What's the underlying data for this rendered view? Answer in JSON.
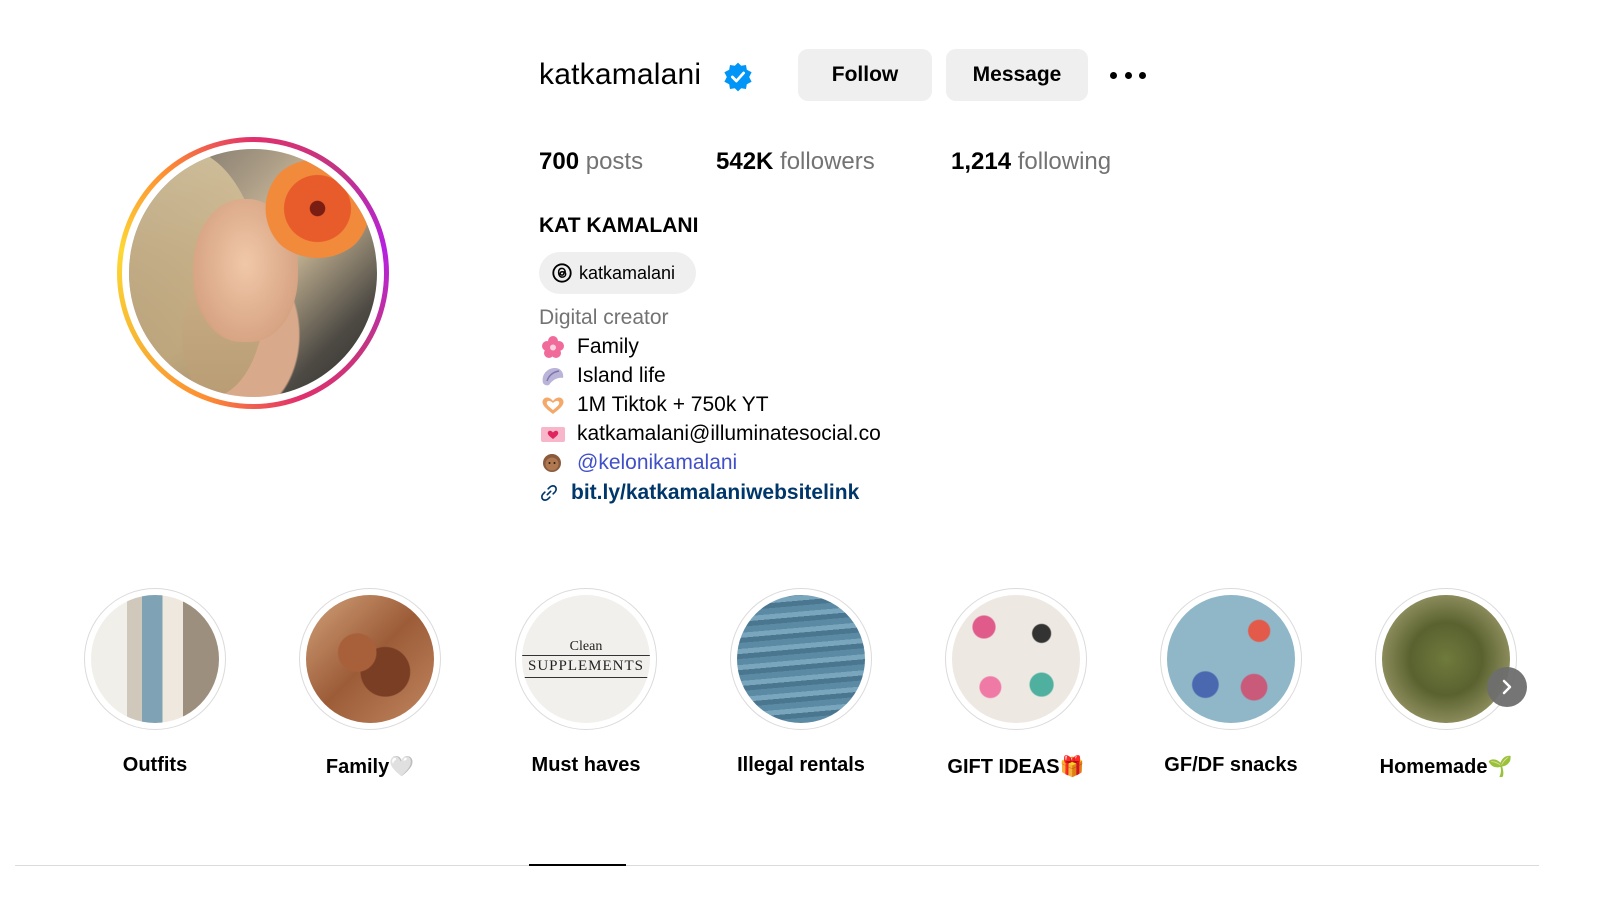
{
  "profile": {
    "username": "katkamalani",
    "verified": true,
    "follow_label": "Follow",
    "message_label": "Message",
    "more_icon": "more-horizontal-icon"
  },
  "stats": {
    "posts_count": "700",
    "posts_label": " posts",
    "followers_count": "542K",
    "followers_label": " followers",
    "following_count": "1,214",
    "following_label": " following"
  },
  "bio": {
    "full_name": "KAT KAMALANI",
    "threads_handle": "katkamalani",
    "category": "Digital creator",
    "lines": [
      {
        "emoji": "hibiscus",
        "text": "Family"
      },
      {
        "emoji": "shell",
        "text": "Island life"
      },
      {
        "emoji": "heart-hands",
        "text": "1M Tiktok + 750k YT"
      },
      {
        "emoji": "love-letter",
        "text": "katkamalani@illuminatesocial.co"
      },
      {
        "emoji": "person",
        "text": "@kelonikamalani"
      }
    ],
    "link": "bit.ly/katkamalaniwebsitelink"
  },
  "highlights": [
    {
      "label": "Outfits"
    },
    {
      "label": "Family🤍"
    },
    {
      "label": "Must haves",
      "cover_text": [
        "Clean",
        "SUPPLEMENTS"
      ]
    },
    {
      "label": "Illegal rentals"
    },
    {
      "label": "GIFT IDEAS🎁"
    },
    {
      "label": "GF/DF snacks"
    },
    {
      "label": "Homemade🌱"
    }
  ],
  "colors": {
    "verified_blue": "#0095f6",
    "link_blue": "#00376b",
    "mention_blue": "#4150c8",
    "button_gray": "#efefef",
    "secondary_text": "#737373"
  }
}
